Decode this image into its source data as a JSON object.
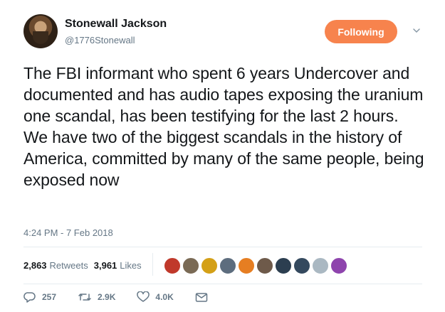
{
  "author": {
    "display_name": "Stonewall Jackson",
    "handle": "@1776Stonewall",
    "avatar_icon": "profile-photo"
  },
  "follow_button": {
    "label": "Following",
    "color": "#f7834d"
  },
  "menu_icon": "chevron-down-icon",
  "tweet": {
    "text": "The FBI informant who spent 6 years Undercover and documented and has audio tapes exposing the uranium one scandal, has been testifying for the last 2 hours. We have two of the biggest scandals in the history of America, committed by many of the same people, being exposed now",
    "timestamp": "4:24 PM - 7 Feb 2018"
  },
  "stats": {
    "retweets_count": "2,863",
    "retweets_label": "Retweets",
    "likes_count": "3,961",
    "likes_label": "Likes"
  },
  "likers": [
    {
      "name": "liker-1",
      "color": "#c0392b"
    },
    {
      "name": "liker-2",
      "color": "#7a6a55"
    },
    {
      "name": "liker-3",
      "color": "#d4a017"
    },
    {
      "name": "liker-4",
      "color": "#5d6d7e"
    },
    {
      "name": "liker-5",
      "color": "#e67e22"
    },
    {
      "name": "liker-6",
      "color": "#6e5a4a"
    },
    {
      "name": "liker-7",
      "color": "#2c3e50"
    },
    {
      "name": "liker-8",
      "color": "#34495e"
    },
    {
      "name": "liker-9",
      "color": "#aab8c2"
    },
    {
      "name": "liker-10",
      "color": "#8e44ad"
    }
  ],
  "actions": {
    "reply_count": "257",
    "retweet_count": "2.9K",
    "like_count": "4.0K"
  }
}
